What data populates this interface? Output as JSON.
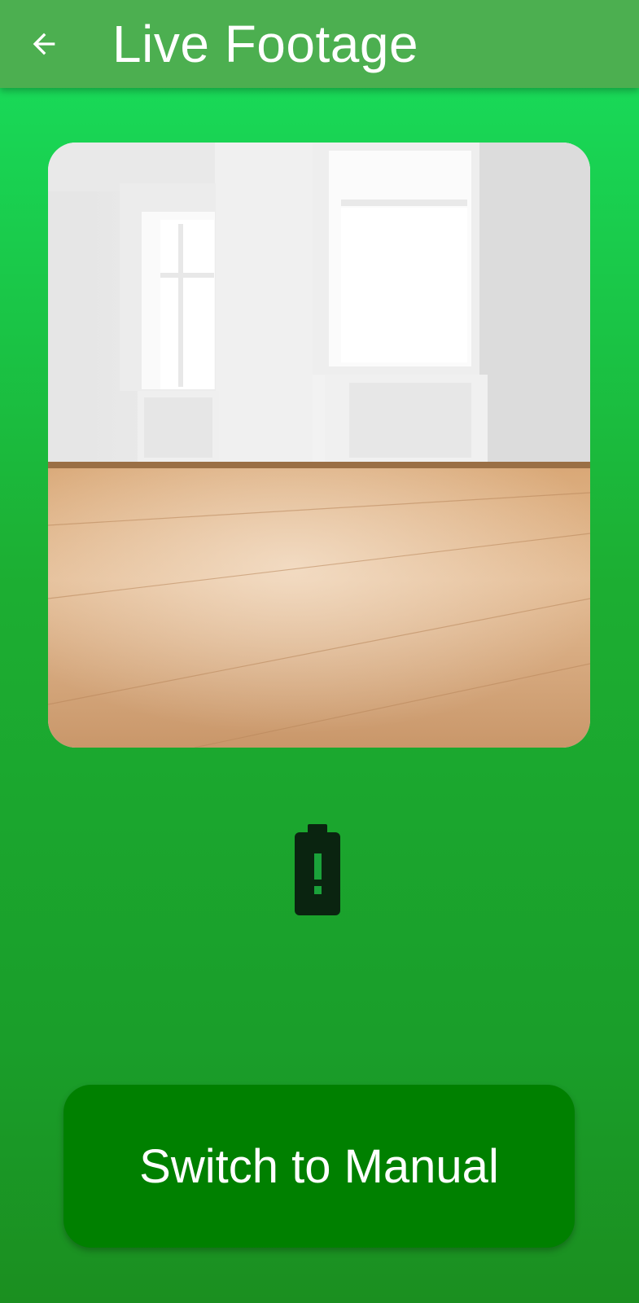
{
  "header": {
    "title": "Live Footage",
    "back_icon": "arrow-back-icon",
    "background": "#4caf50"
  },
  "feed": {
    "content": "live camera image of an empty room with white walls, two windows and a light wooden floor"
  },
  "status": {
    "battery_icon": "battery-alert-icon"
  },
  "actions": {
    "manual_label": "Switch to Manual",
    "manual_color": "#008000"
  },
  "theme": {
    "gradient_top": "#18e05e",
    "gradient_bottom": "#1b8f20"
  }
}
